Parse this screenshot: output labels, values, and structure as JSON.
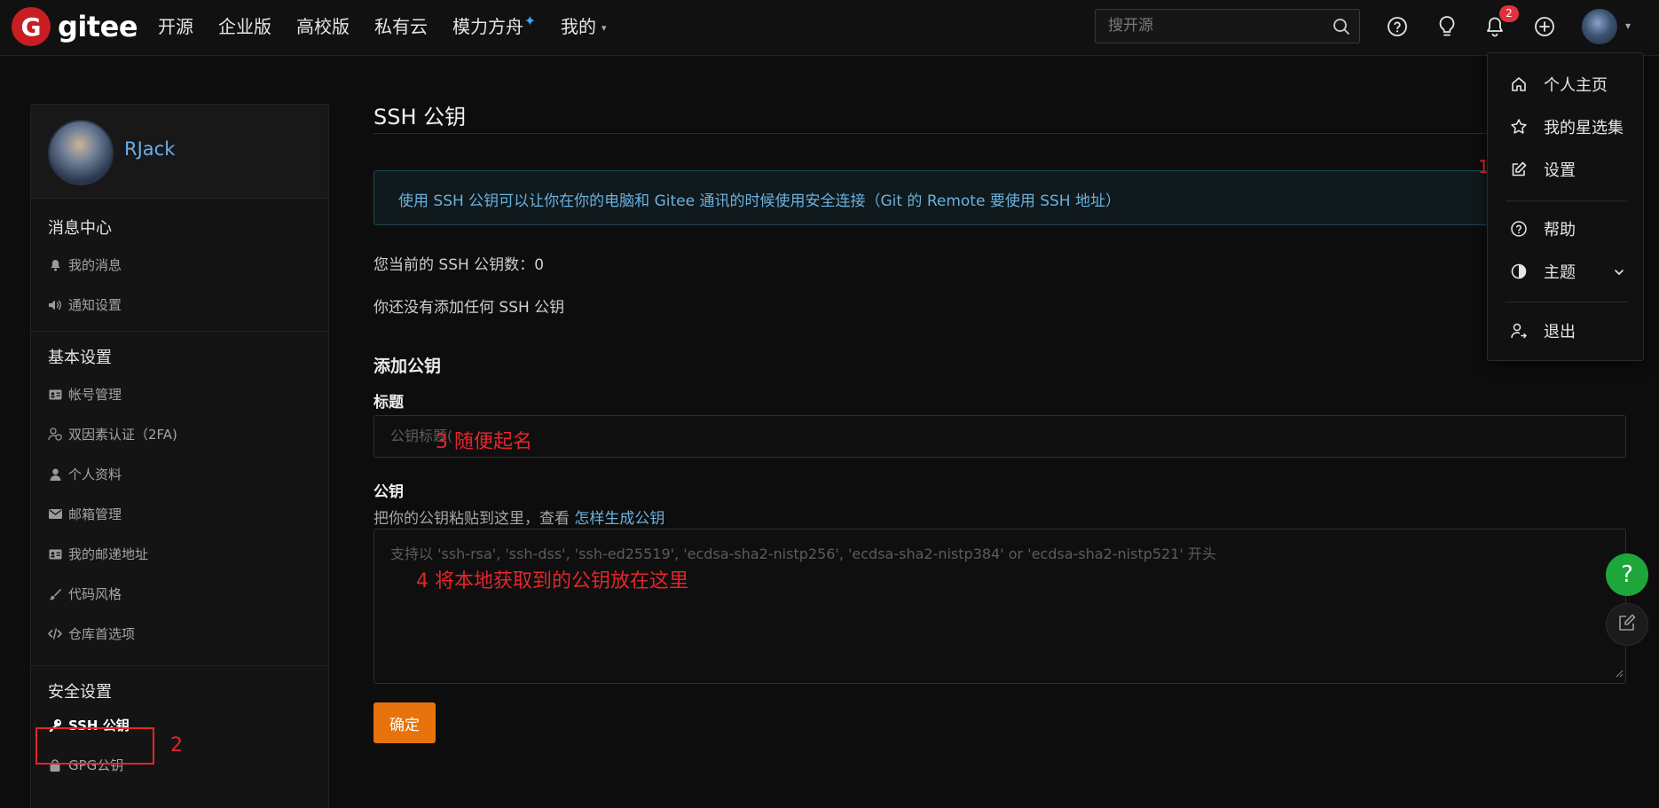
{
  "brand": {
    "logo_letter": "G",
    "name": "gitee"
  },
  "nav": {
    "items": [
      "开源",
      "企业版",
      "高校版",
      "私有云",
      "模力方舟",
      "我的"
    ],
    "star_glyph": "✦",
    "caret_glyph": "▾"
  },
  "search": {
    "placeholder": "搜开源"
  },
  "notifications": {
    "count": "2"
  },
  "sidebar": {
    "username": "RJack",
    "sections": {
      "messages": {
        "title": "消息中心",
        "items": [
          "我的消息",
          "通知设置"
        ]
      },
      "basic": {
        "title": "基本设置",
        "items": [
          "帐号管理",
          "双因素认证（2FA)",
          "个人资料",
          "邮箱管理",
          "我的邮递地址",
          "代码风格",
          "仓库首选项"
        ]
      },
      "security": {
        "title": "安全设置",
        "items": [
          "SSH 公钥",
          "GPG公钥"
        ]
      }
    }
  },
  "main": {
    "title": "SSH 公钥",
    "info": "使用 SSH 公钥可以让你在你的电脑和 Gitee 通讯的时候使用安全连接（Git 的 Remote 要使用 SSH 地址）",
    "count_label": "您当前的 SSH 公钥数：",
    "count_value": "0",
    "empty_text": "你还没有添加任何 SSH 公钥",
    "add_title": "添加公钥",
    "title_label": "标题",
    "title_placeholder": "公钥标题(",
    "key_label": "公钥",
    "key_hint": "把你的公钥粘贴到这里，查看 ",
    "key_hint_link": "怎样生成公钥",
    "key_placeholder": "支持以 'ssh-rsa', 'ssh-dss', 'ssh-ed25519', 'ecdsa-sha2-nistp256', 'ecdsa-sha2-nistp384' or 'ecdsa-sha2-nistp521' 开头",
    "submit_label": "确定"
  },
  "dropdown": {
    "items": [
      "个人主页",
      "我的星选集",
      "设置",
      "帮助",
      "主题",
      "退出"
    ]
  },
  "annotations": {
    "a1": "1",
    "a2": "2",
    "a3": "3  随便起名",
    "a4": "4  将本地获取到的公钥放在这里",
    "color": "#e3262c"
  },
  "fab": {
    "help_glyph": "?"
  },
  "colors": {
    "brand": "#c71d23",
    "accent": "#e8720c",
    "link": "#6ab1df",
    "help": "#1ea63a"
  }
}
